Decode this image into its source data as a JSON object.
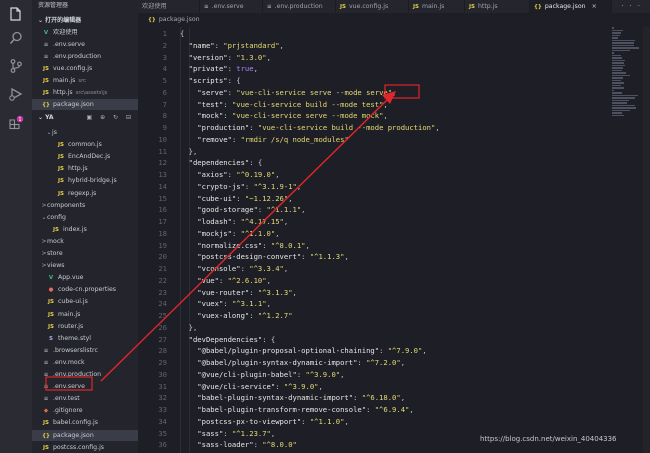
{
  "sidebar": {
    "title": "资源管理器",
    "open_editors_header": "打开的编辑器",
    "open_editors": [
      {
        "icon": "vue",
        "name": "欢迎使用",
        "sub": ""
      },
      {
        "icon": "cfg",
        "name": ".env.serve",
        "sub": ""
      },
      {
        "icon": "cfg",
        "name": ".env.production",
        "sub": ""
      },
      {
        "icon": "js",
        "name": "vue.config.js",
        "sub": ""
      },
      {
        "icon": "js",
        "name": "main.js",
        "sub": "src"
      },
      {
        "icon": "js",
        "name": "http.js",
        "sub": "src\\assets\\js"
      },
      {
        "icon": "json",
        "name": "package.json",
        "sub": ""
      }
    ],
    "project_header": "YA",
    "project_tools": "▣ ⊕ ↻ ⊟",
    "tree": [
      {
        "indent": 2,
        "twisty": "⌄",
        "icon": "",
        "name": "js"
      },
      {
        "indent": 3,
        "twisty": "",
        "icon": "js",
        "name": "common.js"
      },
      {
        "indent": 3,
        "twisty": "",
        "icon": "js",
        "name": "EncAndDec.js"
      },
      {
        "indent": 3,
        "twisty": "",
        "icon": "js",
        "name": "http.js"
      },
      {
        "indent": 3,
        "twisty": "",
        "icon": "js",
        "name": "hybrid-bridge.js"
      },
      {
        "indent": 3,
        "twisty": "",
        "icon": "js",
        "name": "regexp.js"
      },
      {
        "indent": 1,
        "twisty": ">",
        "icon": "",
        "name": "components"
      },
      {
        "indent": 1,
        "twisty": "⌄",
        "icon": "",
        "name": "config"
      },
      {
        "indent": 2,
        "twisty": "",
        "icon": "js",
        "name": "index.js"
      },
      {
        "indent": 1,
        "twisty": ">",
        "icon": "",
        "name": "mock"
      },
      {
        "indent": 1,
        "twisty": ">",
        "icon": "",
        "name": "store"
      },
      {
        "indent": 1,
        "twisty": ">",
        "icon": "",
        "name": "views"
      },
      {
        "indent": 1,
        "twisty": "",
        "icon": "vue",
        "name": "App.vue"
      },
      {
        "indent": 1,
        "twisty": "",
        "icon": "prop",
        "name": "code-cn.properties"
      },
      {
        "indent": 1,
        "twisty": "",
        "icon": "js",
        "name": "cube-ui.js"
      },
      {
        "indent": 1,
        "twisty": "",
        "icon": "js",
        "name": "main.js"
      },
      {
        "indent": 1,
        "twisty": "",
        "icon": "js",
        "name": "router.js"
      },
      {
        "indent": 1,
        "twisty": "",
        "icon": "styl",
        "name": "theme.styl"
      },
      {
        "indent": 0,
        "twisty": "",
        "icon": "cfg",
        "name": ".browserslistrc"
      },
      {
        "indent": 0,
        "twisty": "",
        "icon": "cfg",
        "name": ".env.mock"
      },
      {
        "indent": 0,
        "twisty": "",
        "icon": "cfg",
        "name": ".env.production"
      },
      {
        "indent": 0,
        "twisty": "",
        "icon": "cfg",
        "name": ".env.serve"
      },
      {
        "indent": 0,
        "twisty": "",
        "icon": "cfg",
        "name": ".env.test"
      },
      {
        "indent": 0,
        "twisty": "",
        "icon": "git",
        "name": ".gitignore"
      },
      {
        "indent": 0,
        "twisty": "",
        "icon": "js",
        "name": "babel.config.js"
      },
      {
        "indent": 0,
        "twisty": "",
        "icon": "json",
        "name": "package.json"
      },
      {
        "indent": 0,
        "twisty": "",
        "icon": "js",
        "name": "postcss.config.js"
      }
    ]
  },
  "tabs": [
    {
      "icon": "",
      "label": "欢迎使用",
      "active": false
    },
    {
      "icon": "cfg",
      "label": ".env.serve",
      "active": false
    },
    {
      "icon": "cfg",
      "label": ".env.production",
      "active": false
    },
    {
      "icon": "js",
      "label": "vue.config.js",
      "active": false
    },
    {
      "icon": "js",
      "label": "main.js",
      "active": false
    },
    {
      "icon": "js",
      "label": "http.js",
      "active": false
    },
    {
      "icon": "json",
      "label": "package.json",
      "active": true
    }
  ],
  "tab_close": "×",
  "tab_actions": "▷ ◫ ···",
  "breadcrumb": {
    "icon": "{}",
    "label": "package.json"
  },
  "icons": {
    "js": "JS",
    "json": "{}",
    "cfg": "≡",
    "vue": "V",
    "prop": "●",
    "styl": "S",
    "git": "◆",
    "folder": ""
  },
  "editor": {
    "lines": [
      [
        [
          "p",
          "{"
        ]
      ],
      [
        [
          "k",
          "  \"name\""
        ],
        [
          "p",
          ": "
        ],
        [
          "s",
          "\"prjstandard\""
        ],
        [
          "p",
          ","
        ]
      ],
      [
        [
          "k",
          "  \"version\""
        ],
        [
          "p",
          ": "
        ],
        [
          "s",
          "\"1.3.0\""
        ],
        [
          "p",
          ","
        ]
      ],
      [
        [
          "k",
          "  \"private\""
        ],
        [
          "p",
          ": "
        ],
        [
          "b",
          "true"
        ],
        [
          "p",
          ","
        ]
      ],
      [
        [
          "k",
          "  \"scripts\""
        ],
        [
          "p",
          ": {"
        ]
      ],
      [
        [
          "k",
          "    \"serve\""
        ],
        [
          "p",
          ": "
        ],
        [
          "s",
          "\"vue-cli-service serve --mode serve\""
        ],
        [
          "p",
          ","
        ]
      ],
      [
        [
          "k",
          "    \"test\""
        ],
        [
          "p",
          ": "
        ],
        [
          "s",
          "\"vue-cli-service build --mode test\""
        ],
        [
          "p",
          ","
        ]
      ],
      [
        [
          "k",
          "    \"mock\""
        ],
        [
          "p",
          ": "
        ],
        [
          "s",
          "\"vue-cli-service serve --mode mock\""
        ],
        [
          "p",
          ","
        ]
      ],
      [
        [
          "k",
          "    \"production\""
        ],
        [
          "p",
          ": "
        ],
        [
          "s",
          "\"vue-cli-service build --mode production\""
        ],
        [
          "p",
          ","
        ]
      ],
      [
        [
          "k",
          "    \"remove\""
        ],
        [
          "p",
          ": "
        ],
        [
          "s",
          "\"rmdir /s/q node_modules\""
        ]
      ],
      [
        [
          "p",
          "  },"
        ]
      ],
      [
        [
          "k",
          "  \"dependencies\""
        ],
        [
          "p",
          ": {"
        ]
      ],
      [
        [
          "k",
          "    \"axios\""
        ],
        [
          "p",
          ": "
        ],
        [
          "s",
          "\"^0.19.0\""
        ],
        [
          "p",
          ","
        ]
      ],
      [
        [
          "k",
          "    \"crypto-js\""
        ],
        [
          "p",
          ": "
        ],
        [
          "s",
          "\"^3.1.9-1\""
        ],
        [
          "p",
          ","
        ]
      ],
      [
        [
          "k",
          "    \"cube-ui\""
        ],
        [
          "p",
          ": "
        ],
        [
          "s",
          "\"~1.12.26\""
        ],
        [
          "p",
          ","
        ]
      ],
      [
        [
          "k",
          "    \"good-storage\""
        ],
        [
          "p",
          ": "
        ],
        [
          "s",
          "\"^1.1.1\""
        ],
        [
          "p",
          ","
        ]
      ],
      [
        [
          "k",
          "    \"lodash\""
        ],
        [
          "p",
          ": "
        ],
        [
          "s",
          "\"^4.17.15\""
        ],
        [
          "p",
          ","
        ]
      ],
      [
        [
          "k",
          "    \"mockjs\""
        ],
        [
          "p",
          ": "
        ],
        [
          "s",
          "\"^1.1.0\""
        ],
        [
          "p",
          ","
        ]
      ],
      [
        [
          "k",
          "    \"normalize.css\""
        ],
        [
          "p",
          ": "
        ],
        [
          "s",
          "\"^8.0.1\""
        ],
        [
          "p",
          ","
        ]
      ],
      [
        [
          "k",
          "    \"postcss-design-convert\""
        ],
        [
          "p",
          ": "
        ],
        [
          "s",
          "\"^1.1.3\""
        ],
        [
          "p",
          ","
        ]
      ],
      [
        [
          "k",
          "    \"vconsole\""
        ],
        [
          "p",
          ": "
        ],
        [
          "s",
          "\"^3.3.4\""
        ],
        [
          "p",
          ","
        ]
      ],
      [
        [
          "k",
          "    \"vue\""
        ],
        [
          "p",
          ": "
        ],
        [
          "s",
          "\"^2.6.10\""
        ],
        [
          "p",
          ","
        ]
      ],
      [
        [
          "k",
          "    \"vue-router\""
        ],
        [
          "p",
          ": "
        ],
        [
          "s",
          "\"^3.1.3\""
        ],
        [
          "p",
          ","
        ]
      ],
      [
        [
          "k",
          "    \"vuex\""
        ],
        [
          "p",
          ": "
        ],
        [
          "s",
          "\"^3.1.1\""
        ],
        [
          "p",
          ","
        ]
      ],
      [
        [
          "k",
          "    \"vuex-along\""
        ],
        [
          "p",
          ": "
        ],
        [
          "s",
          "\"^1.2.7\""
        ]
      ],
      [
        [
          "p",
          "  },"
        ]
      ],
      [
        [
          "k",
          "  \"devDependencies\""
        ],
        [
          "p",
          ": {"
        ]
      ],
      [
        [
          "k",
          "    \"@babel/plugin-proposal-optional-chaining\""
        ],
        [
          "p",
          ": "
        ],
        [
          "s",
          "\"^7.9.0\""
        ],
        [
          "p",
          ","
        ]
      ],
      [
        [
          "k",
          "    \"@babel/plugin-syntax-dynamic-import\""
        ],
        [
          "p",
          ": "
        ],
        [
          "s",
          "\"^7.2.0\""
        ],
        [
          "p",
          ","
        ]
      ],
      [
        [
          "k",
          "    \"@vue/cli-plugin-babel\""
        ],
        [
          "p",
          ": "
        ],
        [
          "s",
          "\"^3.9.0\""
        ],
        [
          "p",
          ","
        ]
      ],
      [
        [
          "k",
          "    \"@vue/cli-service\""
        ],
        [
          "p",
          ": "
        ],
        [
          "s",
          "\"^3.9.0\""
        ],
        [
          "p",
          ","
        ]
      ],
      [
        [
          "k",
          "    \"babel-plugin-syntax-dynamic-import\""
        ],
        [
          "p",
          ": "
        ],
        [
          "s",
          "\"^6.18.0\""
        ],
        [
          "p",
          ","
        ]
      ],
      [
        [
          "k",
          "    \"babel-plugin-transform-remove-console\""
        ],
        [
          "p",
          ": "
        ],
        [
          "s",
          "\"^6.9.4\""
        ],
        [
          "p",
          ","
        ]
      ],
      [
        [
          "k",
          "    \"postcss-px-to-viewport\""
        ],
        [
          "p",
          ": "
        ],
        [
          "s",
          "\"^1.1.0\""
        ],
        [
          "p",
          ","
        ]
      ],
      [
        [
          "k",
          "    \"sass\""
        ],
        [
          "p",
          ": "
        ],
        [
          "s",
          "\"^1.23.7\""
        ],
        [
          "p",
          ","
        ]
      ],
      [
        [
          "k",
          "    \"sass-loader\""
        ],
        [
          "p",
          ": "
        ],
        [
          "s",
          "\"^8.0.0\""
        ]
      ]
    ]
  },
  "watermark": "https://blog.csdn.net/weixin_40404336",
  "annotation_color": "#e0262a"
}
